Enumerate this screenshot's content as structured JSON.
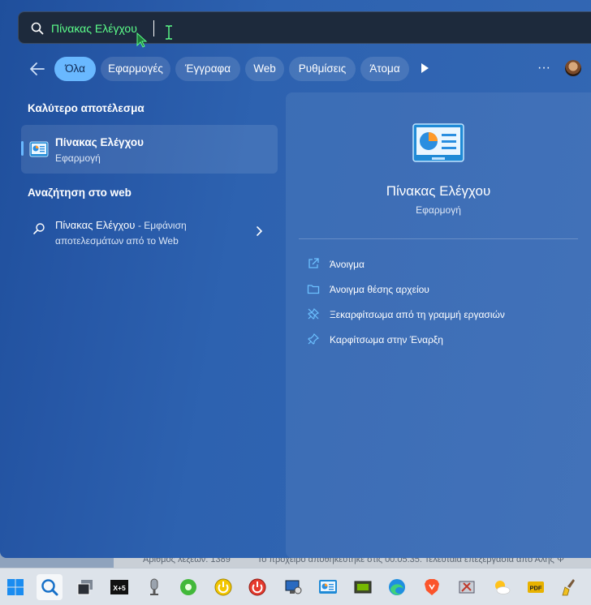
{
  "search": {
    "query": "Πίνακας Ελέγχου"
  },
  "filters": [
    "Όλα",
    "Εφαρμογές",
    "Έγγραφα",
    "Web",
    "Ρυθμίσεις",
    "Άτομα"
  ],
  "more": "···",
  "best_match": {
    "section_title": "Καλύτερο αποτέλεσμα",
    "title": "Πίνακας Ελέγχου",
    "subtitle": "Εφαρμογή"
  },
  "web_search": {
    "section_title": "Αναζήτηση στο web",
    "query": "Πίνακας Ελέγχου",
    "suffix": "- Εμφάνιση",
    "line2": "αποτελεσμάτων από το Web"
  },
  "detail": {
    "name": "Πίνακας Ελέγχου",
    "kind": "Εφαρμογή",
    "actions": [
      {
        "icon": "open-external-icon",
        "label": "Άνοιγμα"
      },
      {
        "icon": "folder-icon",
        "label": "Άνοιγμα θέσης αρχείου"
      },
      {
        "icon": "unpin-icon",
        "label": "Ξεκαρφίτσωμα από τη γραμμή εργασιών"
      },
      {
        "icon": "pin-icon",
        "label": "Καρφίτσωμα στην Έναρξη"
      }
    ]
  },
  "background_doc": {
    "left_text": "Αριθμός λέξεων: 1389",
    "right_text": "Το πρόχειρο αποθηκεύτηκε στις 00:05:35. Τελευταία επεξεργασία από Αλής Ψ"
  },
  "taskbar": {
    "items": [
      "start-icon",
      "search-icon",
      "task-view-icon",
      "xplus5-icon",
      "microphone-icon",
      "green-app-icon",
      "yellow-power-icon",
      "red-power-icon",
      "monitor-app-icon",
      "control-panel-icon",
      "gpu-app-icon",
      "edge-icon",
      "brave-icon",
      "tools-app-icon",
      "weather-icon",
      "pdf-icon",
      "cleaner-icon"
    ],
    "xplus5_label": "X+5",
    "pdf_label": "PDF"
  },
  "colors": {
    "accent": "#69b8ff",
    "query_text": "#5cff8a",
    "panel": "#2d62b0"
  }
}
